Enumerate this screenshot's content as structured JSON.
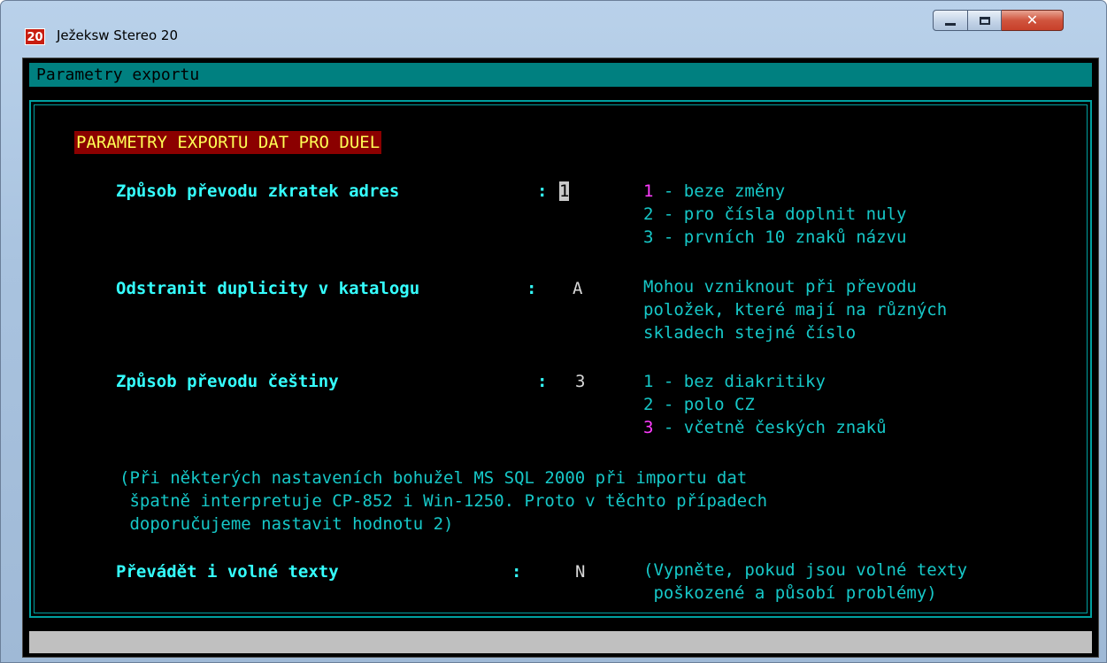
{
  "window": {
    "icon_text": "20",
    "title": "Ježeksw Stereo 20"
  },
  "header": {
    "title": "Parametry exportu"
  },
  "section_title": "PARAMETRY EXPORTU DAT PRO DUEL",
  "fields": [
    {
      "label": "Způsob převodu zkratek adres",
      "sep": ":",
      "value": "1",
      "options": [
        "1",
        "2",
        "3"
      ],
      "option_texts": [
        " - beze změny",
        " - pro čísla doplnit nuly",
        " - prvních 10 znaků názvu"
      ],
      "selected_index": 0
    },
    {
      "label": "Odstranit duplicity v katalogu",
      "sep": ":",
      "value": "A",
      "notes": [
        "Mohou vzniknout při převodu",
        "položek, které mají na různých",
        "skladech stejné číslo"
      ]
    },
    {
      "label": "Způsob převodu češtiny",
      "sep": ":",
      "value": "3",
      "options": [
        "1",
        "2",
        "3"
      ],
      "option_texts": [
        " - bez diakritiky",
        " - polo CZ",
        " - včetně českých znaků"
      ],
      "selected_index": 2
    },
    {
      "label": "Převádět i volné texty",
      "sep": ":",
      "value": "N",
      "notes": [
        "(Vypněte, pokud jsou volné texty",
        " poškozené a působí problémy)"
      ]
    }
  ],
  "note_lines": [
    "(Při některých nastaveních bohužel MS SQL 2000 při importu dat",
    " špatně interpretuje CP-852 i Win-1250. Proto v těchto případech",
    " doporučujeme nastavit hodnotu 2)"
  ],
  "colors": {
    "console_bg": "#000000",
    "header_bg": "#008080",
    "frame": "#00a0a0",
    "section_bg": "#8b0000",
    "section_text": "#ffff55",
    "highlight": "#ff3cff",
    "label": "#35ffff",
    "status_bar": "#c0c0c0"
  },
  "icons": {
    "minimize": "minimize-icon",
    "maximize": "maximize-icon",
    "close": "close-icon",
    "app": "app-icon"
  }
}
